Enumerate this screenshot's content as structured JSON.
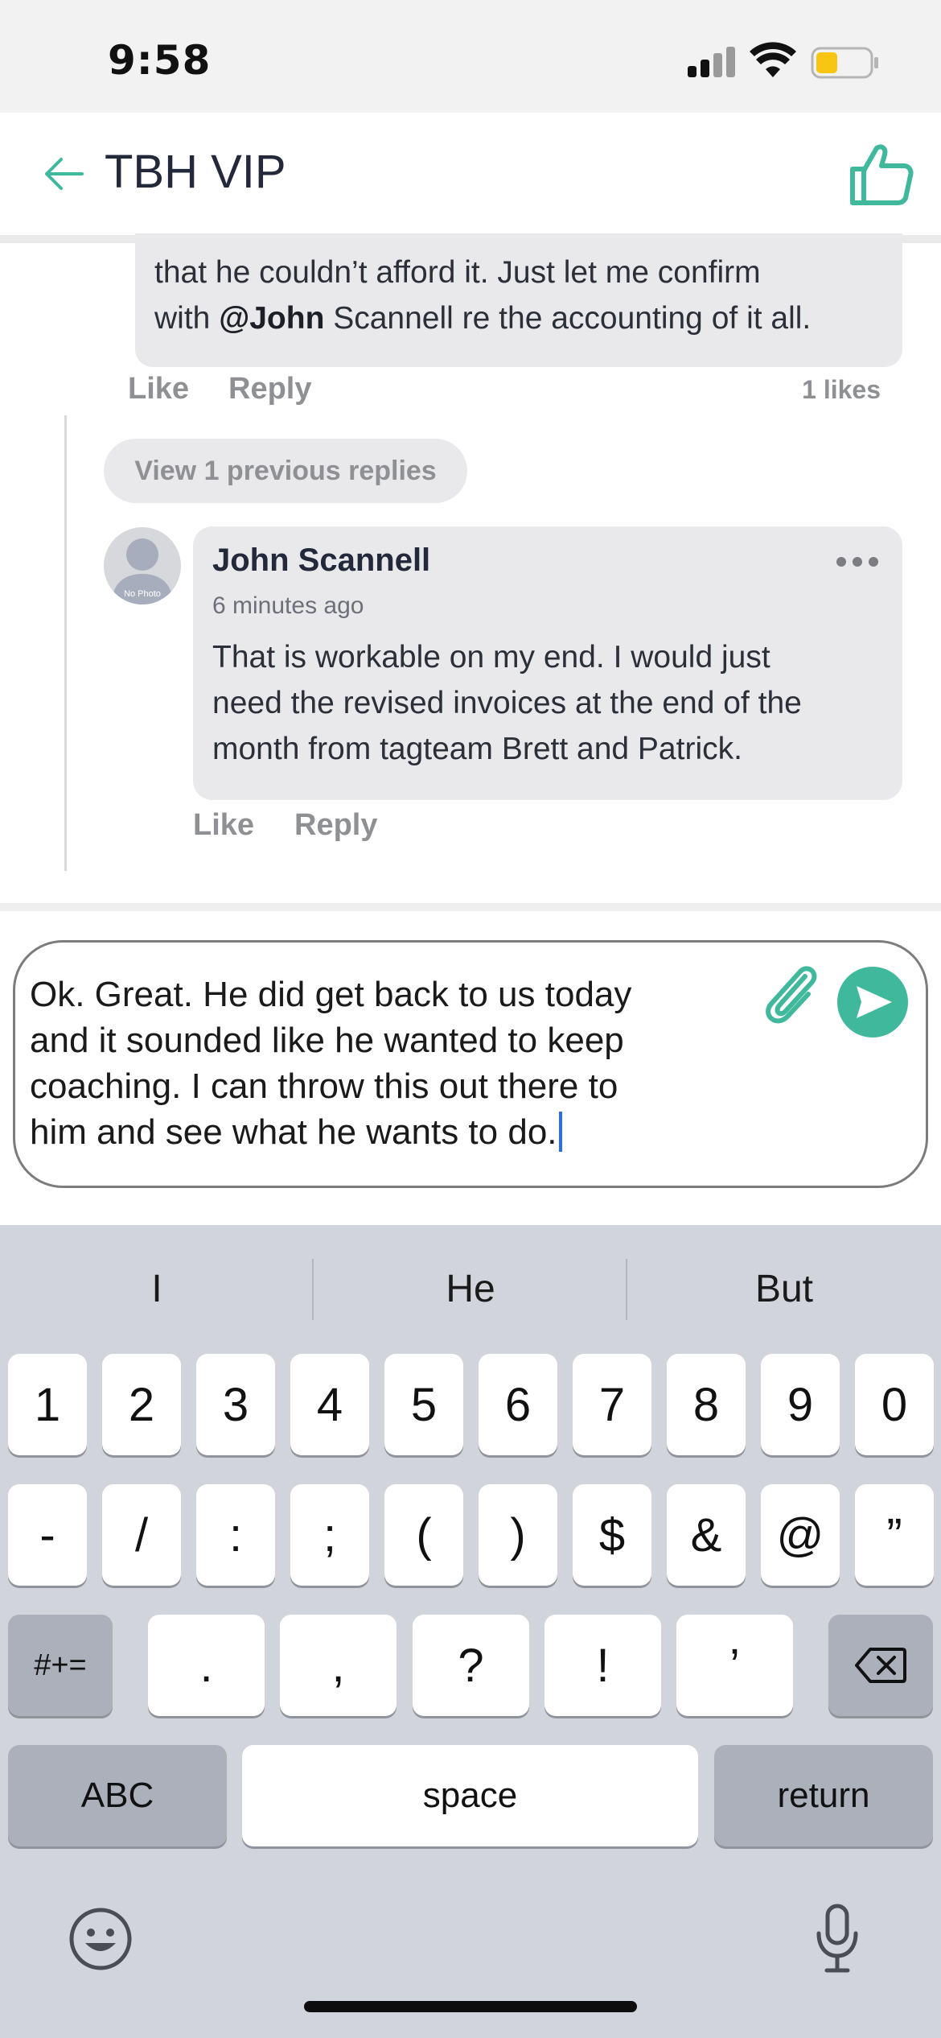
{
  "status_bar": {
    "time": "9:58"
  },
  "header": {
    "title": "TBH VIP"
  },
  "thread": {
    "parent_comment": {
      "line1": "that he couldn’t afford it.  Just let me confirm",
      "line2_pre": "with ",
      "mention": "@John",
      "line2_post": " Scannell re the accounting of it all.",
      "like_label": "Like",
      "reply_label": "Reply",
      "likes_count": "1 likes"
    },
    "view_previous_label": "View 1 previous replies",
    "reply": {
      "avatar_text": "No Photo",
      "author": "John Scannell",
      "time_ago": "6 minutes ago",
      "body": "That is workable on my end. I would just\nneed the revised invoices at the end of the\nmonth from tagteam Brett and Patrick.",
      "like_label": "Like",
      "reply_label": "Reply"
    }
  },
  "composer": {
    "text": "Ok.  Great.  He did get back to us today\nand it sounded like he wanted to keep\ncoaching.  I can throw this out there to\nhim and see what he wants to do."
  },
  "keyboard": {
    "suggestions": [
      "I",
      "He",
      "But"
    ],
    "row1": [
      "1",
      "2",
      "3",
      "4",
      "5",
      "6",
      "7",
      "8",
      "9",
      "0"
    ],
    "row2": [
      "-",
      "/",
      ":",
      ";",
      "(",
      ")",
      "$",
      "&",
      "@",
      "”"
    ],
    "row3": {
      "shift_label": "#+=",
      "keys": [
        ".",
        ",",
        "?",
        "!",
        "’"
      ]
    },
    "row4": {
      "abc_label": "ABC",
      "space_label": "space",
      "return_label": "return"
    }
  },
  "colors": {
    "accent": "#3fb89c",
    "bubble": "#e9e9ec",
    "keyboard_bg": "#d1d4db",
    "muted_text": "#8e9094"
  }
}
